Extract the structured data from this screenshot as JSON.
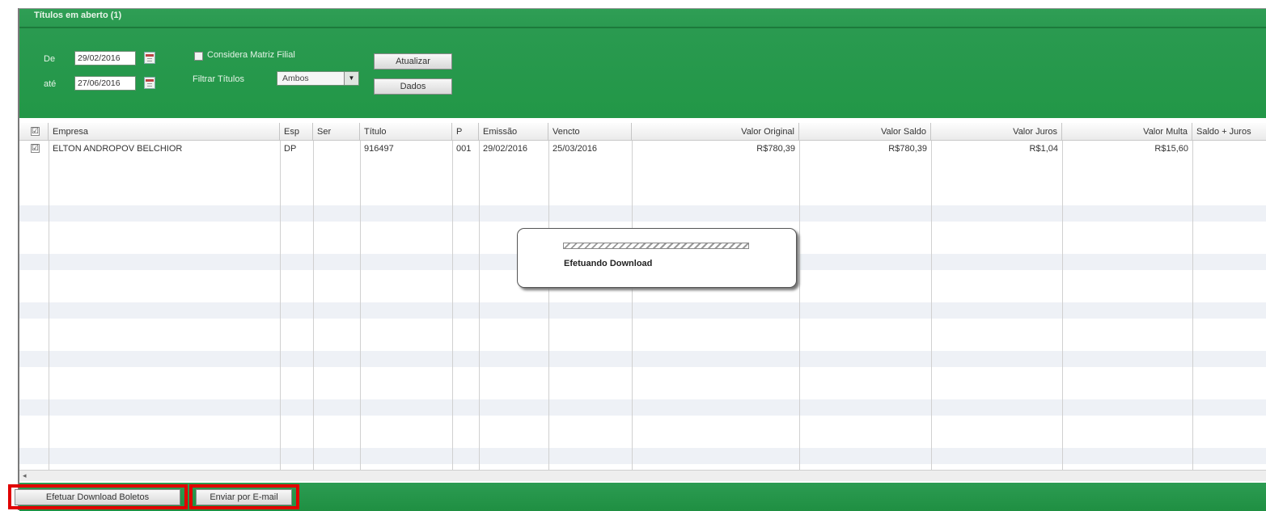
{
  "window": {
    "title": "Títulos em aberto (1)"
  },
  "filters": {
    "de_label": "De",
    "ate_label": "até",
    "date_from": "29/02/2016",
    "date_to": "27/06/2016",
    "considera_label": "Considera Matriz Filial",
    "filtrar_label": "Filtrar Títulos",
    "filtrar_value": "Ambos",
    "atualizar_button": "Atualizar",
    "dados_button": "Dados"
  },
  "table": {
    "columns": [
      "Empresa",
      "Esp",
      "Ser",
      "Título",
      "P",
      "Emissão",
      "Vencto",
      "Valor Original",
      "Valor Saldo",
      "Valor Juros",
      "Valor Multa",
      "Saldo + Juros"
    ],
    "rows": [
      {
        "checked": "☑",
        "empresa": "ELTON ANDROPOV BELCHIOR",
        "esp": "DP",
        "ser": "",
        "titulo": "916497",
        "p": "001",
        "emissao": "29/02/2016",
        "vencto": "25/03/2016",
        "valor_original": "R$780,39",
        "valor_saldo": "R$780,39",
        "valor_juros": "R$1,04",
        "valor_multa": "R$15,60",
        "saldo_juros": ""
      }
    ]
  },
  "header_check": "☑",
  "scroll_left_arrow": "◂",
  "select_arrow": "▼",
  "modal": {
    "text": "Efetuando Download"
  },
  "footer": {
    "download_button": "Efetuar Download Boletos",
    "email_button": "Enviar por E-mail"
  },
  "colors": {
    "header_green": "#229747",
    "highlight_red": "#e00000"
  }
}
